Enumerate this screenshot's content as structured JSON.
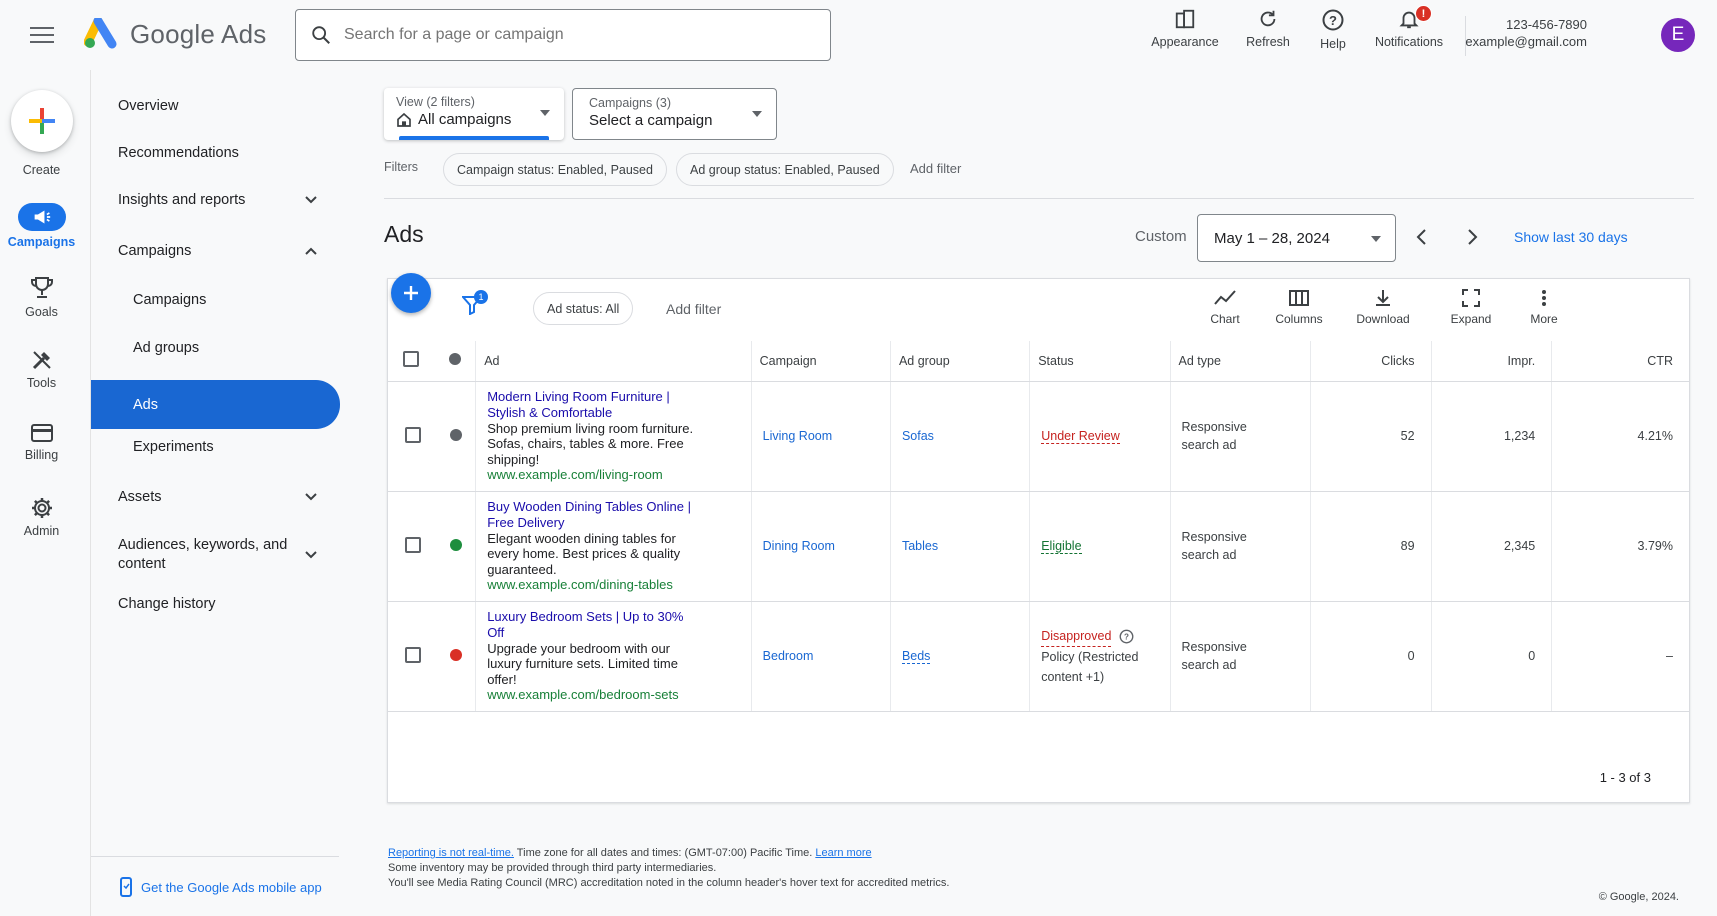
{
  "app": {
    "logo_text": "Google Ads"
  },
  "search": {
    "placeholder": "Search for a page or campaign"
  },
  "header_tools": {
    "appearance": "Appearance",
    "refresh": "Refresh",
    "help": "Help",
    "notifications": "Notifications",
    "notification_badge": "!"
  },
  "account": {
    "phone": "123-456-7890",
    "email": "example@gmail.com",
    "avatar_letter": "E"
  },
  "rail": {
    "create": "Create",
    "campaigns": "Campaigns",
    "goals": "Goals",
    "tools": "Tools",
    "billing": "Billing",
    "admin": "Admin"
  },
  "nav": {
    "overview": "Overview",
    "recommendations": "Recommendations",
    "insights": "Insights and reports",
    "campaigns_group": "Campaigns",
    "campaigns": "Campaigns",
    "ad_groups": "Ad groups",
    "ads": "Ads",
    "experiments": "Experiments",
    "assets": "Assets",
    "audiences": "Audiences, keywords, and content",
    "change_history": "Change history",
    "mobile_app": "Get the Google Ads mobile app"
  },
  "view_selector": {
    "label": "View (2 filters)",
    "value": "All campaigns"
  },
  "campaign_selector": {
    "label": "Campaigns (3)",
    "value": "Select a campaign"
  },
  "filters": {
    "label": "Filters",
    "chips": [
      "Campaign status: Enabled, Paused",
      "Ad group status: Enabled, Paused"
    ],
    "add": "Add filter"
  },
  "page_title": "Ads",
  "date": {
    "mode": "Custom",
    "range": "May 1 – 28, 2024",
    "show_last": "Show last 30 days"
  },
  "table_toolbar": {
    "filter_badge": "1",
    "ad_status_chip": "Ad status: All",
    "add_filter": "Add filter",
    "chart": "Chart",
    "columns": "Columns",
    "download": "Download",
    "expand": "Expand",
    "more": "More"
  },
  "columns": [
    "Ad",
    "Campaign",
    "Ad group",
    "Status",
    "Ad type",
    "Clicks",
    "Impr.",
    "CTR"
  ],
  "rows": [
    {
      "dot_color": "#5f6368",
      "title1": "Modern Living Room Furniture |",
      "title2": "Stylish & Comfortable",
      "desc1": "Shop premium living room furniture.",
      "desc2": "Sofas, chairs, tables & more. Free",
      "desc3": "shipping!",
      "url": "www.example.com/living-room",
      "campaign": "Living Room",
      "ad_group": "Sofas",
      "status": "Under Review",
      "status_color": "#c5221f",
      "ad_type1": "Responsive",
      "ad_type2": "search ad",
      "clicks": "52",
      "impr": "1,234",
      "ctr": "4.21%"
    },
    {
      "dot_color": "#1e8e3e",
      "title1": "Buy Wooden Dining Tables Online |",
      "title2": "Free Delivery",
      "desc1": "Elegant wooden dining tables for",
      "desc2": "every home. Best prices & quality",
      "desc3": "guaranteed.",
      "url": "www.example.com/dining-tables",
      "campaign": "Dining Room",
      "ad_group": "Tables",
      "status": "Eligible",
      "status_color": "#137333",
      "ad_type1": "Responsive",
      "ad_type2": "search ad",
      "clicks": "89",
      "impr": "2,345",
      "ctr": "3.79%"
    },
    {
      "dot_color": "#d93025",
      "title1": "Luxury Bedroom Sets | Up to 30%",
      "title2": "Off",
      "desc1": "Upgrade your bedroom with our",
      "desc2": "luxury furniture sets. Limited time",
      "desc3": "offer!",
      "url": "www.example.com/bedroom-sets",
      "campaign": "Bedroom",
      "ad_group": "Beds",
      "status": "Disapproved",
      "status_color": "#c5221f",
      "status_sub1": "Policy (Restricted",
      "status_sub2": "content +1)",
      "ad_type1": "Responsive",
      "ad_type2": "search ad",
      "clicks": "0",
      "impr": "0",
      "ctr": "–"
    }
  ],
  "pagination": "1 - 3 of 3",
  "footer": {
    "reporting_link": "Reporting is not real-time.",
    "tz": " Time zone for all dates and times: (GMT-07:00) Pacific Time. ",
    "learn_more": "Learn more",
    "line2": "Some inventory may be provided through third party intermediaries.",
    "line3": "You'll see Media Rating Council (MRC) accreditation noted in the column header's hover text for accredited metrics.",
    "copyright": "© Google, 2024."
  }
}
